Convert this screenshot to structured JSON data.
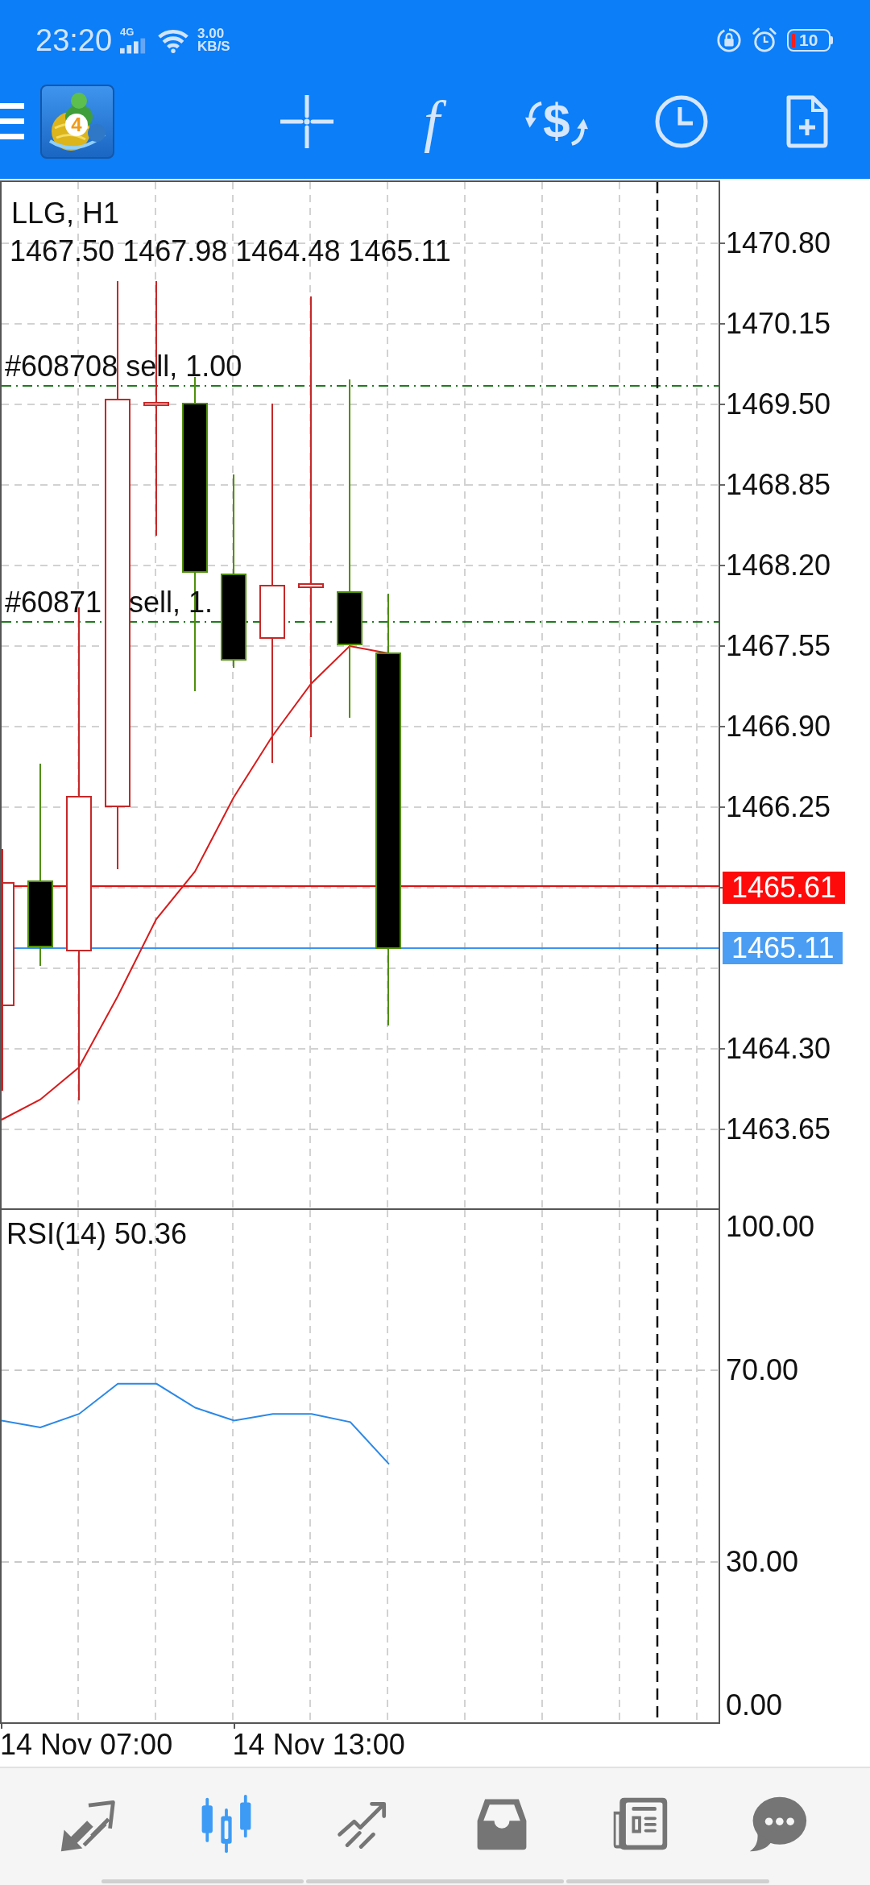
{
  "status_bar": {
    "time": "23:20",
    "network_type": "4G",
    "speed_value": "3.00",
    "speed_unit": "KB/S",
    "battery_percent": "10"
  },
  "toolbar": {
    "logo_badge": "4",
    "tools": [
      {
        "kind": "crosshair"
      },
      {
        "kind": "function",
        "symbol": "f"
      },
      {
        "kind": "trade",
        "symbol": "$"
      },
      {
        "kind": "period"
      },
      {
        "kind": "new_order"
      }
    ]
  },
  "chart": {
    "title": "LLG, H1",
    "ohlc": "1467.50 1467.98 1464.48 1465.11",
    "orders": [
      {
        "label_parts": [
          "#608708 sell, 1.00"
        ]
      },
      {
        "label_parts": [
          "#60871",
          "sell, 1."
        ]
      }
    ],
    "price_axis": {
      "upper_labels": [
        "1470.80",
        "1470.15",
        "1469.50",
        "1468.85",
        "1468.20",
        "1467.55",
        "1466.90",
        "1466.25"
      ],
      "ask_tag": "1465.61",
      "bid_tag": "1465.11",
      "lower_labels": [
        "1464.30",
        "1463.65"
      ]
    }
  },
  "rsi_panel": {
    "chart_data": {
      "type": "line",
      "title": "RSI(14) 50.36",
      "grid": true,
      "ylim": [
        -3.5,
        103.5
      ],
      "yticks": [
        {
          "value": 100,
          "label": "100.00"
        },
        {
          "value": 70,
          "label": "70.00"
        },
        {
          "value": 30,
          "label": "30.00"
        },
        {
          "value": 0,
          "label": "0.00"
        }
      ],
      "series": [
        {
          "color": "#2b88e6",
          "values": [
            59.5,
            58.1,
            60.9,
            67.2,
            67.2,
            62.2,
            59.5,
            60.9,
            60.9,
            59.2,
            50.4
          ]
        }
      ]
    }
  },
  "time_axis": {
    "labels": [
      "14 Nov 07:00",
      "14 Nov 13:00"
    ]
  },
  "bottom_nav": {
    "items": [
      {
        "kind": "quotes",
        "selected": false
      },
      {
        "kind": "chart",
        "selected": true
      },
      {
        "kind": "trade",
        "selected": false
      },
      {
        "kind": "history",
        "selected": false
      },
      {
        "kind": "news",
        "selected": false
      },
      {
        "kind": "chat",
        "selected": false
      }
    ]
  }
}
